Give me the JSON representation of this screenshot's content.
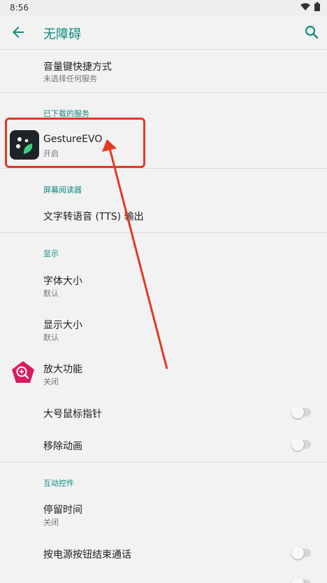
{
  "status_bar": {
    "time": "8:56"
  },
  "app_bar": {
    "title": "无障碍"
  },
  "items": {
    "volume_shortcut": {
      "title": "音量键快捷方式",
      "summary": "未选择任何服务"
    },
    "downloaded_header": "已下载的服务",
    "gesture_evo": {
      "title": "GestureEVO",
      "summary": "开启"
    },
    "screen_reader_header": "屏幕阅读器",
    "tts": {
      "title": "文字转语音 (TTS) 输出"
    },
    "display_header": "显示",
    "font_size": {
      "title": "字体大小",
      "summary": "默认"
    },
    "display_size": {
      "title": "显示大小",
      "summary": "默认"
    },
    "magnification": {
      "title": "放大功能",
      "summary": "关闭"
    },
    "large_pointer": {
      "title": "大号鼠标指针",
      "toggle": false
    },
    "remove_animations": {
      "title": "移除动画",
      "toggle": false
    },
    "interaction_header": "互动控件",
    "dwell_time": {
      "title": "停留时间",
      "summary": "关闭"
    },
    "power_ends_call": {
      "title": "按电源按钮结束通话",
      "toggle": false
    }
  },
  "colors": {
    "accent": "#0f8a80",
    "annotation": "#e03a25",
    "magnify_icon": "#d81b60"
  },
  "icons": [
    "arrow-back-icon",
    "search-icon",
    "wifi-icon",
    "battery-icon",
    "gesture-evo-app-icon",
    "magnification-icon"
  ]
}
